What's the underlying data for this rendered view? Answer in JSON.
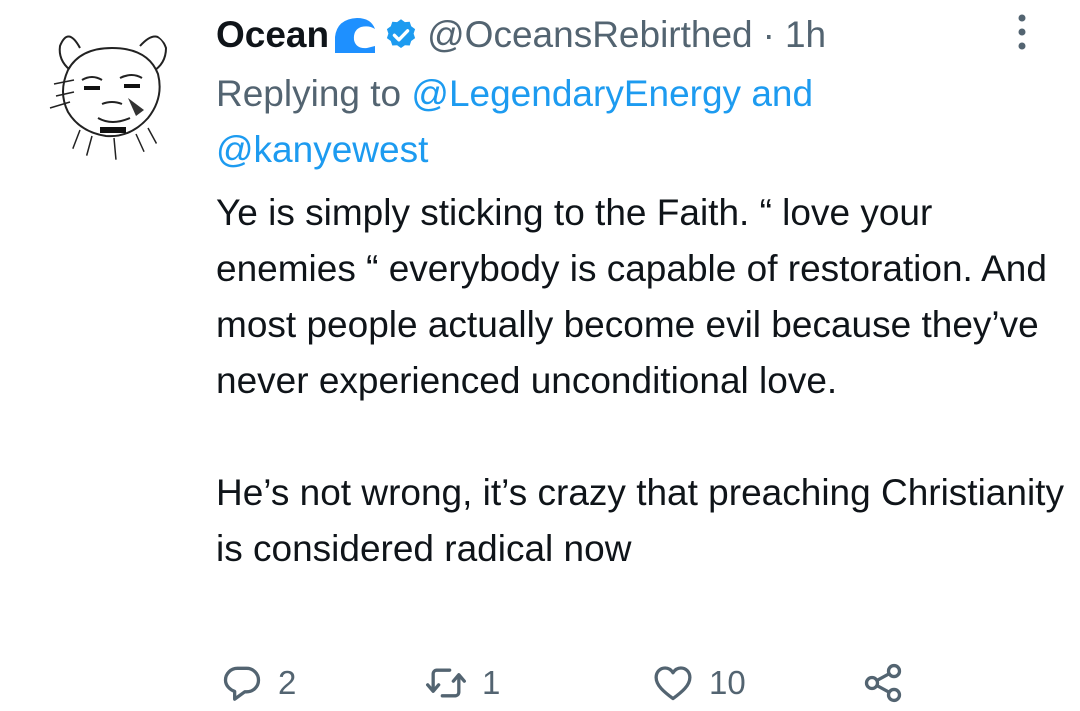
{
  "tweet": {
    "author_name": "Ocean",
    "author_emoji_icon": "water-wave-icon",
    "verified_icon": "verified-badge-icon",
    "handle": "@OceansRebirthed",
    "separator": "·",
    "time": "1h",
    "reply_prefix": "Replying to",
    "reply_mention_1": "@LegendaryEnergy",
    "reply_conjunction": "and",
    "reply_mention_2": "@kanyewest",
    "paragraphs": [
      "Ye is simply sticking to the Faith. “ love your enemies “ everybody is capable of restoration. And most people actually become evil because they’ve never experienced unconditional love.",
      "He’s not wrong, it’s crazy that preaching Christianity is considered radical now"
    ]
  },
  "actions": {
    "reply_count": "2",
    "retweet_count": "1",
    "like_count": "10"
  },
  "colors": {
    "text": "#0f1419",
    "muted": "#536471",
    "link": "#1d9bf0",
    "verified": "#1d9bf0",
    "wave": "#1e90ff"
  }
}
